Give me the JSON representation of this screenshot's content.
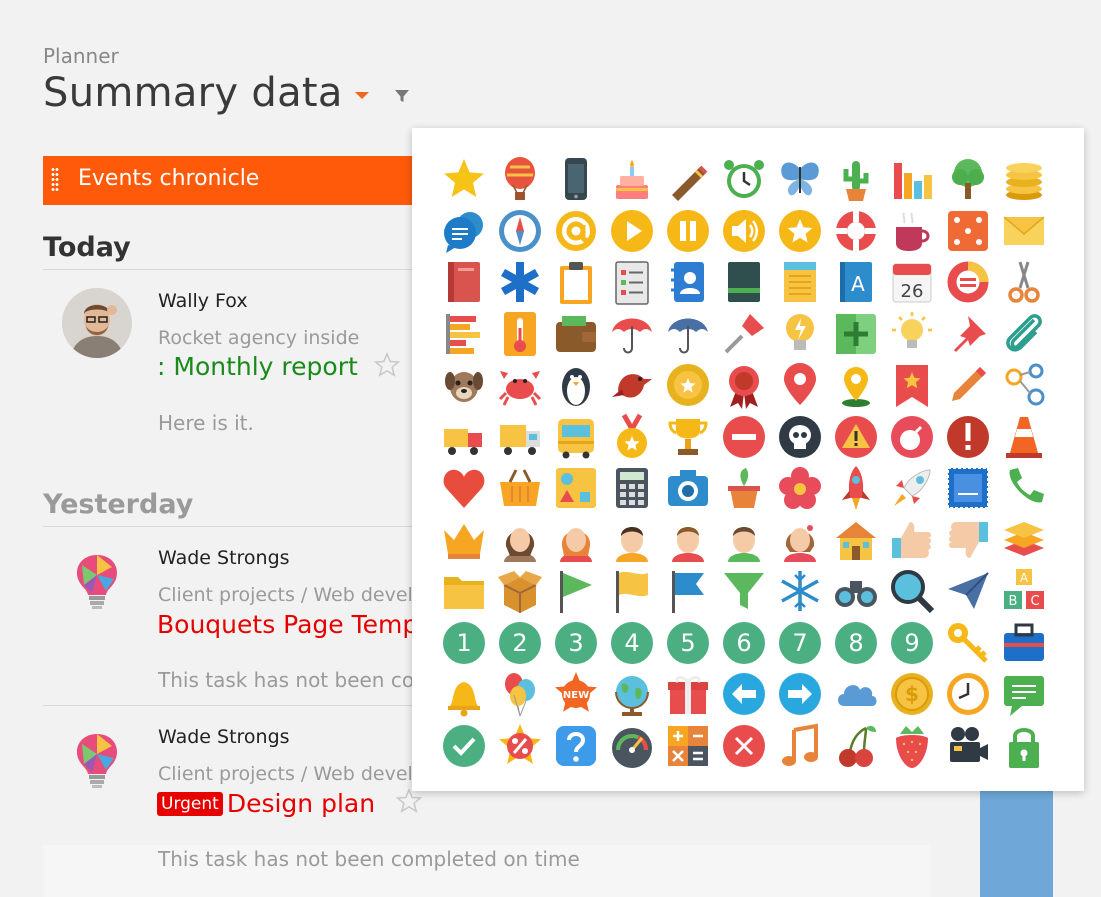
{
  "breadcrumb": "Planner",
  "page_title": "Summary data",
  "chronicle_label": "Events chronicle",
  "today": {
    "heading": "Today",
    "event": {
      "author": "Wally Fox",
      "project": "Rocket agency inside",
      "task": ": Monthly report",
      "task_color": "#1a8a1a",
      "comment": "Here is it."
    }
  },
  "yesterday": {
    "heading": "Yesterday",
    "events": [
      {
        "author": "Wade Strongs",
        "project": "Client projects / Web devel",
        "task": "Bouquets Page Temp",
        "task_color": "#e60000",
        "comment": "This task has not been co"
      },
      {
        "author": "Wade Strongs",
        "project": "Client projects / Web devel",
        "badge": "Urgent",
        "task": "Design plan",
        "task_color": "#e60000",
        "comment": "This task has not been completed on time"
      }
    ]
  },
  "icon_picker": {
    "rows": [
      [
        "star-icon",
        "hot-air-balloon-icon",
        "smartphone-icon",
        "birthday-cake-icon",
        "cigar-icon",
        "alarm-clock-icon",
        "butterfly-icon",
        "cactus-icon",
        "bar-chart-icon",
        "tree-icon",
        "coins-icon"
      ],
      [
        "chat-bubbles-icon",
        "compass-icon",
        "at-sign-icon",
        "play-icon",
        "pause-icon",
        "speaker-icon",
        "star-badge-icon",
        "lifebuoy-icon",
        "coffee-cup-icon",
        "dice-icon",
        "envelope-icon"
      ],
      [
        "book-icon",
        "medical-star-icon",
        "clipboard-icon",
        "checklist-icon",
        "address-book-icon",
        "notebook-icon",
        "notepad-icon",
        "letter-book-icon",
        "calendar-icon",
        "donut-chart-icon",
        "scissors-icon"
      ],
      [
        "stacked-bars-icon",
        "thermometer-icon",
        "wallet-icon",
        "open-umbrella-icon",
        "closed-umbrella-icon",
        "screwdriver-icon",
        "idea-bulb-icon",
        "plus-card-icon",
        "lightbulb-icon",
        "push-pin-icon",
        "paperclip-icon"
      ],
      [
        "dog-icon",
        "crab-icon",
        "penguin-icon",
        "bird-icon",
        "award-medal-icon",
        "rosette-icon",
        "map-pin-icon",
        "location-marker-icon",
        "bookmark-star-icon",
        "pencil-icon",
        "share-icon"
      ],
      [
        "tow-truck-icon",
        "delivery-truck-icon",
        "school-bus-icon",
        "gold-medal-icon",
        "trophy-icon",
        "no-entry-icon",
        "skull-icon",
        "warning-icon",
        "bomb-icon",
        "exclamation-icon",
        "traffic-cone-icon"
      ],
      [
        "heart-icon",
        "shopping-basket-icon",
        "shapes-icon",
        "calculator-icon",
        "camera-icon",
        "flower-pot-icon",
        "flower-icon",
        "rocket-icon",
        "flying-rocket-icon",
        "postage-stamp-icon",
        "phone-icon"
      ],
      [
        "crown-icon",
        "woman-icon",
        "redhead-girl-icon",
        "boy-icon",
        "man-icon",
        "young-man-icon",
        "girl-icon",
        "house-icon",
        "thumbs-up-icon",
        "thumbs-down-icon",
        "layers-icon"
      ],
      [
        "folder-icon",
        "open-box-icon",
        "green-flag-icon",
        "yellow-flag-icon",
        "blue-flag-icon",
        "funnel-icon",
        "snowflake-icon",
        "binoculars-icon",
        "magnifier-icon",
        "paper-plane-icon",
        "abc-blocks-icon"
      ],
      [
        "number-1-icon",
        "number-2-icon",
        "number-3-icon",
        "number-4-icon",
        "number-5-icon",
        "number-6-icon",
        "number-7-icon",
        "number-8-icon",
        "number-9-icon",
        "key-icon",
        "briefcase-icon"
      ],
      [
        "bell-icon",
        "balloons-icon",
        "new-badge-icon",
        "globe-icon",
        "gift-icon",
        "arrow-left-icon",
        "arrow-right-icon",
        "cloud-icon",
        "dollar-coin-icon",
        "clock-icon",
        "message-icon"
      ],
      [
        "check-icon",
        "percent-badge-icon",
        "question-icon",
        "speedometer-icon",
        "math-operations-icon",
        "close-circle-icon",
        "music-note-icon",
        "cherries-icon",
        "strawberry-icon",
        "movie-camera-icon",
        "padlock-icon"
      ]
    ],
    "number_labels": [
      "1",
      "2",
      "3",
      "4",
      "5",
      "6",
      "7",
      "8",
      "9"
    ],
    "new_label": "NEW",
    "calendar_day": "26",
    "letter_book_label": "A",
    "abc_labels": [
      "A",
      "B",
      "C"
    ]
  },
  "colors": {
    "accent": "#ff5a0a",
    "today_task": "#1a8a1a",
    "overdue_task": "#e60000",
    "panel_blue": "#6fa8d8"
  }
}
